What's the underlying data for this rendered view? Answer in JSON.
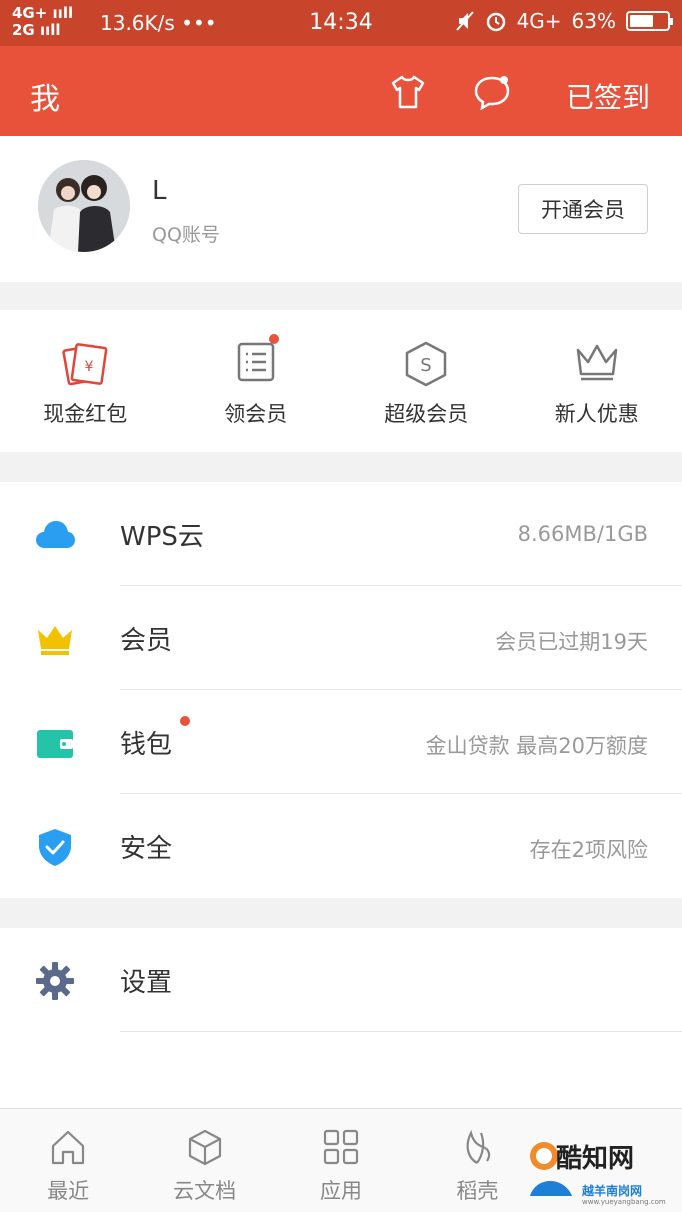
{
  "status_bar": {
    "net1": "4G+ ııll",
    "net2": "2G ııll",
    "speed": "13.6K/s •••",
    "time": "14:34",
    "net_right": "4G+",
    "battery": "63%",
    "battery_level": 0.63
  },
  "header": {
    "title": "我",
    "signed_label": "已签到"
  },
  "profile": {
    "name": "L",
    "account_type": "QQ账号",
    "vip_button": "开通会员"
  },
  "quick_actions": [
    {
      "label": "现金红包",
      "icon": "red-envelope-icon"
    },
    {
      "label": "领会员",
      "icon": "list-icon",
      "badge": true
    },
    {
      "label": "超级会员",
      "icon": "super-vip-icon"
    },
    {
      "label": "新人优惠",
      "icon": "crown-outline-icon"
    }
  ],
  "menu": [
    {
      "label": "WPS云",
      "value": "8.66MB/1GB",
      "icon": "cloud-icon"
    },
    {
      "label": "会员",
      "value": "会员已过期19天",
      "icon": "crown-icon"
    },
    {
      "label": "钱包",
      "value": "金山贷款 最高20万额度",
      "icon": "wallet-icon",
      "badge": true
    },
    {
      "label": "安全",
      "value": "存在2项风险",
      "icon": "shield-icon"
    }
  ],
  "settings": {
    "label": "设置",
    "icon": "gear-icon"
  },
  "bottom_nav": [
    {
      "label": "最近",
      "icon": "home-icon"
    },
    {
      "label": "云文档",
      "icon": "cube-icon"
    },
    {
      "label": "应用",
      "icon": "grid-icon"
    },
    {
      "label": "稻壳",
      "icon": "leaf-icon"
    }
  ],
  "watermark": {
    "name": "酷知网",
    "line2": "越羊南岗网",
    "url": "www.yueyangbang.com"
  },
  "colors": {
    "status_bar": "#c8442b",
    "header": "#e9523a",
    "badge": "#e9523a",
    "cloud": "#2a9ef0",
    "crown": "#f2c200",
    "wallet": "#25c4a8",
    "shield": "#2a9ef0",
    "gear": "#5b6a8a"
  }
}
